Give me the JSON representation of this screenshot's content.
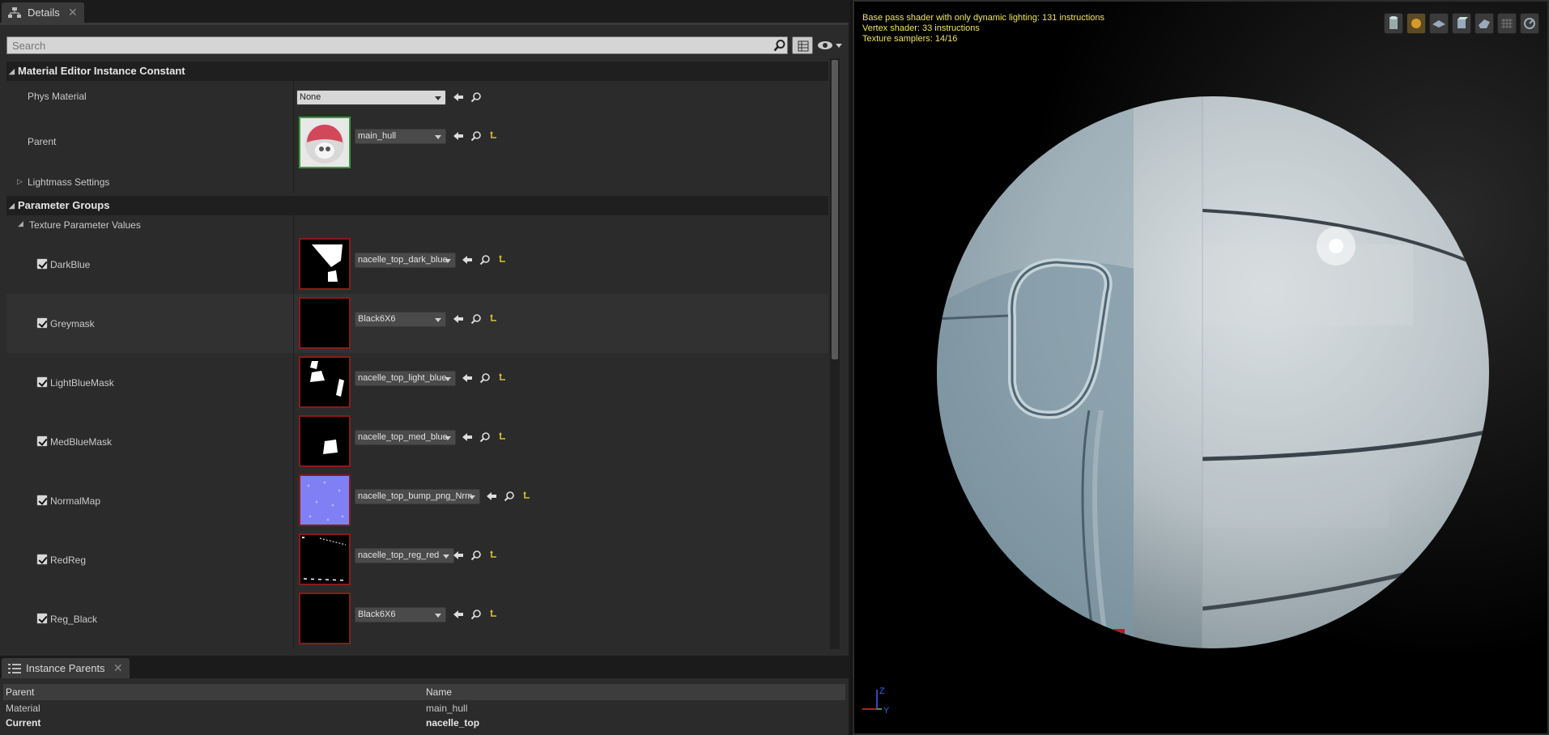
{
  "details": {
    "tab_label": "Details",
    "search_placeholder": "Search",
    "material_section": "Material Editor Instance Constant",
    "phys_material_label": "Phys Material",
    "phys_material_value": "None",
    "parent_label": "Parent",
    "parent_value": "main_hull",
    "lightmass_label": "Lightmass Settings",
    "param_groups_section": "Parameter Groups",
    "texture_params_label": "Texture Parameter Values",
    "textures": [
      {
        "name": "DarkBlue",
        "value": "nacelle_top_dark_blue"
      },
      {
        "name": "Greymask",
        "value": "Black6X6"
      },
      {
        "name": "LightBlueMask",
        "value": "nacelle_top_light_blue"
      },
      {
        "name": "MedBlueMask",
        "value": "nacelle_top_med_blue"
      },
      {
        "name": "NormalMap",
        "value": "nacelle_top_bump_png_Nrm"
      },
      {
        "name": "RedReg",
        "value": "nacelle_top_reg_red"
      },
      {
        "name": "Reg_Black",
        "value": "Black6X6"
      }
    ]
  },
  "instance_parents": {
    "tab_label": "Instance Parents",
    "col_parent": "Parent",
    "col_name": "Name",
    "rows": [
      {
        "parent": "Material",
        "name": "main_hull"
      },
      {
        "parent": "Current",
        "name": "nacelle_top"
      }
    ]
  },
  "viewport": {
    "stats": [
      "Base pass shader with only dynamic lighting: 131 instructions",
      "Vertex shader: 33 instructions",
      "Texture samplers: 14/16"
    ],
    "axis_z": "Z",
    "axis_y": "Y",
    "toolbar_icons": [
      "cylinder-icon",
      "sphere-icon",
      "plane-icon",
      "cube-icon",
      "mesh-icon",
      "grid-icon",
      "realtime-icon"
    ]
  },
  "colors": {
    "stats_text": "#f0e65a",
    "accent_yellow": "#c9a227",
    "parent_thumb_border": "#3c9a3c",
    "texture_thumb_border": "#8a1a1a"
  }
}
